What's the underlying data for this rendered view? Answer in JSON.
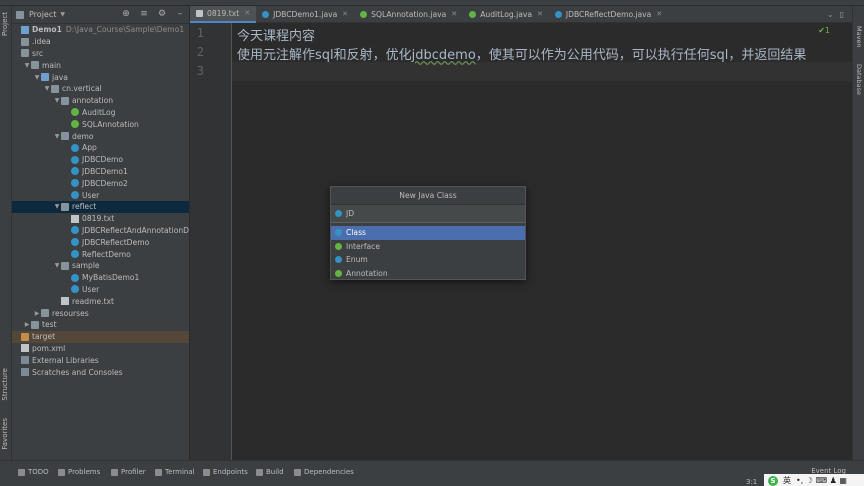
{
  "project": {
    "title": "Project",
    "tree": [
      {
        "label": "Demo1",
        "path": "D:\\Java_Course\\Sample\\Demo1",
        "indent": 0,
        "icon": "module",
        "arrow": "",
        "bold": true
      },
      {
        "label": ".idea",
        "indent": 0,
        "icon": "folder",
        "arrow": ""
      },
      {
        "label": "src",
        "indent": 0,
        "icon": "folder",
        "arrow": ""
      },
      {
        "label": "main",
        "indent": 1,
        "icon": "folder",
        "arrow": "down"
      },
      {
        "label": "java",
        "indent": 2,
        "icon": "folder-blue",
        "arrow": "down"
      },
      {
        "label": "cn.vertical",
        "indent": 3,
        "icon": "package",
        "arrow": "down"
      },
      {
        "label": "annotation",
        "indent": 4,
        "icon": "package",
        "arrow": "down"
      },
      {
        "label": "AuditLog",
        "indent": 5,
        "icon": "annotation",
        "arrow": ""
      },
      {
        "label": "SQLAnnotation",
        "indent": 5,
        "icon": "annotation",
        "arrow": ""
      },
      {
        "label": "demo",
        "indent": 4,
        "icon": "package",
        "arrow": "down"
      },
      {
        "label": "App",
        "indent": 5,
        "icon": "class",
        "arrow": ""
      },
      {
        "label": "JDBCDemo",
        "indent": 5,
        "icon": "class",
        "arrow": ""
      },
      {
        "label": "JDBCDemo1",
        "indent": 5,
        "icon": "class",
        "arrow": ""
      },
      {
        "label": "JDBCDemo2",
        "indent": 5,
        "icon": "class",
        "arrow": ""
      },
      {
        "label": "User",
        "indent": 5,
        "icon": "class",
        "arrow": ""
      },
      {
        "label": "reflect",
        "indent": 4,
        "icon": "package",
        "arrow": "down",
        "selected": true
      },
      {
        "label": "0819.txt",
        "indent": 5,
        "icon": "text",
        "arrow": ""
      },
      {
        "label": "JDBCReflectAndAnnotationDemo",
        "indent": 5,
        "icon": "class",
        "arrow": ""
      },
      {
        "label": "JDBCReflectDemo",
        "indent": 5,
        "icon": "class",
        "arrow": ""
      },
      {
        "label": "ReflectDemo",
        "indent": 5,
        "icon": "class",
        "arrow": ""
      },
      {
        "label": "sample",
        "indent": 4,
        "icon": "package",
        "arrow": "down"
      },
      {
        "label": "MyBatisDemo1",
        "indent": 5,
        "icon": "class",
        "arrow": ""
      },
      {
        "label": "User",
        "indent": 5,
        "icon": "class",
        "arrow": ""
      },
      {
        "label": "readme.txt",
        "indent": 4,
        "icon": "text",
        "arrow": ""
      },
      {
        "label": "resourses",
        "indent": 2,
        "icon": "folder",
        "arrow": "right"
      },
      {
        "label": "test",
        "indent": 1,
        "icon": "folder",
        "arrow": "right"
      },
      {
        "label": "target",
        "indent": 0,
        "icon": "folder-orange",
        "arrow": "",
        "target": true
      },
      {
        "label": "pom.xml",
        "indent": 0,
        "icon": "maven",
        "arrow": ""
      },
      {
        "label": "External Libraries",
        "indent": 0,
        "icon": "library",
        "arrow": ""
      },
      {
        "label": "Scratches and Consoles",
        "indent": 0,
        "icon": "scratch",
        "arrow": ""
      }
    ]
  },
  "left_strip": {
    "project": "Project",
    "structure": "Structure",
    "favorites": "Favorites"
  },
  "right_strip": {
    "maven": "Maven",
    "database": "Database"
  },
  "tabs": [
    {
      "label": "0819.txt",
      "active": true,
      "icon": "text"
    },
    {
      "label": "JDBCDemo1.java",
      "icon": "class"
    },
    {
      "label": "SQLAnnotation.java",
      "icon": "annotation"
    },
    {
      "label": "AuditLog.java",
      "icon": "annotation"
    },
    {
      "label": "JDBCReflectDemo.java",
      "icon": "class"
    }
  ],
  "editor": {
    "line_numbers": [
      "1",
      "2",
      "3"
    ],
    "line1": "今天课程内容",
    "line2_pre": "使用元注解作sql和反射，优化",
    "line2_squiggle": "jdbcdemo",
    "line2_post": "，使其可以作为公用代码，可以执行任何sql，并返回结果",
    "line3": "",
    "inspection": "✔1"
  },
  "dialog": {
    "title": "New Java Class",
    "input_value": "JD",
    "options": [
      {
        "label": "Class",
        "color": "#3592c4",
        "selected": true
      },
      {
        "label": "Interface",
        "color": "#62b543"
      },
      {
        "label": "Enum",
        "color": "#3592c4"
      },
      {
        "label": "Annotation",
        "color": "#62b543"
      }
    ]
  },
  "bottom": {
    "windows": [
      {
        "label": "TODO",
        "icon": "list-icon"
      },
      {
        "label": "Problems",
        "icon": "problems-icon"
      },
      {
        "label": "Profiler",
        "icon": "profiler-icon"
      },
      {
        "label": "Terminal",
        "icon": "terminal-icon"
      },
      {
        "label": "Endpoints",
        "icon": "endpoints-icon"
      },
      {
        "label": "Build",
        "icon": "build-icon"
      },
      {
        "label": "Dependencies",
        "icon": "dependencies-icon"
      }
    ],
    "event_log": "Event Log",
    "status": "3:1",
    "ime": {
      "badge": "S",
      "lang": "英",
      "extra": "•, ☽ ⌨ ♟ ▦"
    }
  }
}
